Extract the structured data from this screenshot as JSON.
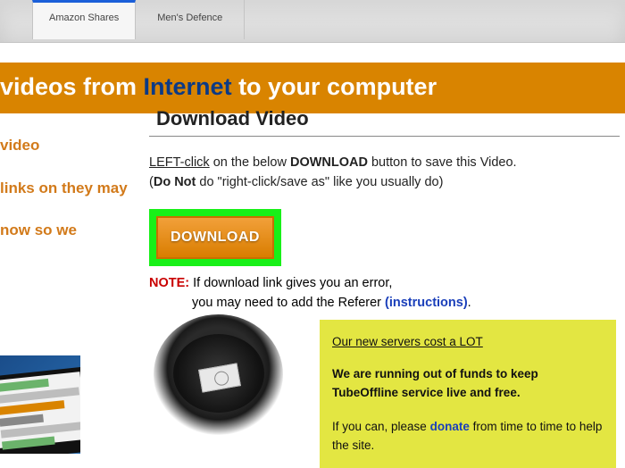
{
  "ads": {
    "tab1": "Amazon Shares",
    "tab2": "Men's Defence"
  },
  "banner": {
    "pre": "videos from ",
    "hl": "Internet",
    "post": " to your computer"
  },
  "sidebar": {
    "l1": "video",
    "l2": "links on they may",
    "l3": "now so we"
  },
  "page": {
    "title": "Download Video",
    "instr_lead": "LEFT-click",
    "instr_mid": " on the below ",
    "instr_dl": "DOWNLOAD",
    "instr_tail": " button to save this Video.",
    "instr2_pre": "(",
    "instr2_b": "Do Not",
    "instr2_post": " do \"right-click/save as\" like you usually do)",
    "download_label": "DOWNLOAD",
    "note_label": "NOTE:",
    "note_text": " If download link gives you an error,",
    "note_text2": "you may need to add the Referer ",
    "note_link": "(instructions)",
    "note_dot": "."
  },
  "notice": {
    "lead": "Our new servers cost a LOT",
    "bold": "We are running out of funds to keep TubeOffline service live and free.",
    "tail_pre": "If you can, please ",
    "donate": "donate",
    "tail_post": " from time to time to help the site."
  }
}
